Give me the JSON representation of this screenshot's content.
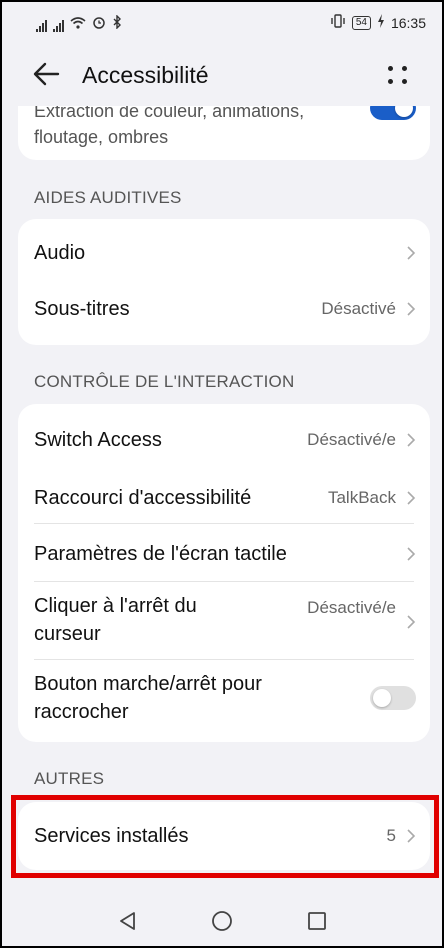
{
  "status_bar": {
    "battery": "54",
    "time": "16:35"
  },
  "header": {
    "title": "Accessibilité"
  },
  "top_card": {
    "text": "Extraction de couleur, animations, floutage, ombres",
    "toggle_on": true
  },
  "hearing": {
    "section_title": "AIDES AUDITIVES",
    "items": [
      {
        "label": "Audio",
        "value": ""
      },
      {
        "label": "Sous-titres",
        "value": "Désactivé"
      }
    ]
  },
  "interaction": {
    "section_title": "CONTRÔLE DE L'INTERACTION",
    "items": [
      {
        "label": "Switch Access",
        "value": "Désactivé/e"
      },
      {
        "label": "Raccourci d'accessibilité",
        "value": "TalkBack"
      },
      {
        "label": "Paramètres de l'écran tactile",
        "value": ""
      },
      {
        "label": "Cliquer à l'arrêt du curseur",
        "value": "Désactivé/e"
      },
      {
        "label": "Bouton marche/arrêt pour raccrocher",
        "toggle_on": false
      }
    ]
  },
  "others": {
    "section_title": "AUTRES",
    "items": [
      {
        "label": "Services installés",
        "value": "5"
      }
    ]
  },
  "colors": {
    "accent": "#1a5ec8",
    "highlight": "#e00000",
    "background": "#f2f2f6"
  }
}
